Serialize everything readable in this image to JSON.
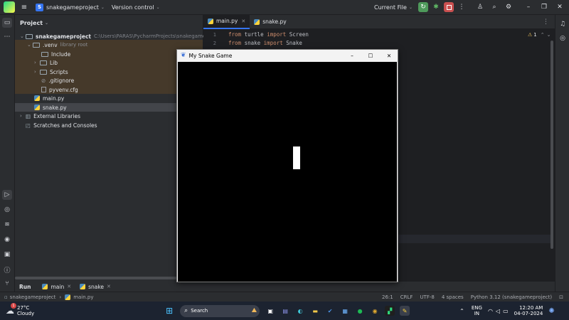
{
  "titlebar": {
    "project_badge": "S",
    "project_name": "snakegameproject",
    "version_control": "Version control",
    "run_config": "Current File"
  },
  "project_panel": {
    "title": "Project",
    "tree": [
      {
        "label": "snakegameproject",
        "extra": "C:\\Users\\PARAS\\PycharmProjects\\snakegameproject"
      },
      {
        "label": ".venv",
        "extra": "library root"
      },
      {
        "label": "Include"
      },
      {
        "label": "Lib"
      },
      {
        "label": "Scripts"
      },
      {
        "label": ".gitignore"
      },
      {
        "label": "pyvenv.cfg"
      },
      {
        "label": "main.py"
      },
      {
        "label": "snake.py"
      },
      {
        "label": "External Libraries"
      },
      {
        "label": "Scratches and Consoles"
      }
    ]
  },
  "editor": {
    "tabs": [
      {
        "label": "main.py",
        "active": true
      },
      {
        "label": "snake.py",
        "active": false
      }
    ],
    "warning_count": "1",
    "lines": [
      {
        "num": "1",
        "kw1": "from",
        "mod": " turtle ",
        "kw2": "import",
        "name": " Screen"
      },
      {
        "num": "2",
        "kw1": "from",
        "mod": " snake ",
        "kw2": "import",
        "name": " Snake"
      }
    ]
  },
  "snake_window": {
    "title": "My Snake Game",
    "minimize": "–",
    "maximize": "☐",
    "close": "✕"
  },
  "run_strip": {
    "run_label": "Run",
    "tabs": [
      "main",
      "snake"
    ]
  },
  "statusbar": {
    "breadcrumb_project": "snakegameproject",
    "breadcrumb_file": "main.py",
    "position": "26:1",
    "line_sep": "CRLF",
    "encoding": "UTF-8",
    "indent": "4 spaces",
    "interpreter": "Python 3.12 (snakegameproject)"
  },
  "taskbar": {
    "weather_temp": "27°C",
    "weather_desc": "Cloudy",
    "weather_badge": "1",
    "search_placeholder": "Search",
    "lang_1": "ENG",
    "lang_2": "IN",
    "time": "12:20 AM",
    "date": "04-07-2024"
  }
}
